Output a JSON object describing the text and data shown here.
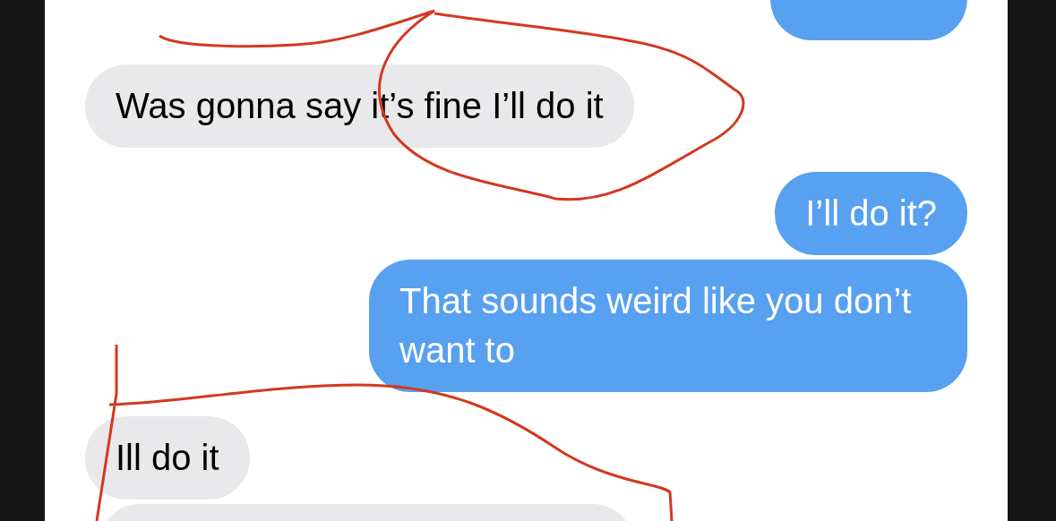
{
  "messages": [
    {
      "kind": "sent"
    },
    {
      "kind": "received",
      "text": "Was gonna say it’s fine I’ll do it"
    },
    {
      "kind": "sent",
      "text": "I’ll do it?"
    },
    {
      "kind": "sent",
      "text": "That sounds weird like you don’t want to"
    },
    {
      "kind": "received",
      "text": "Ill do it"
    },
    {
      "kind": "received"
    }
  ]
}
